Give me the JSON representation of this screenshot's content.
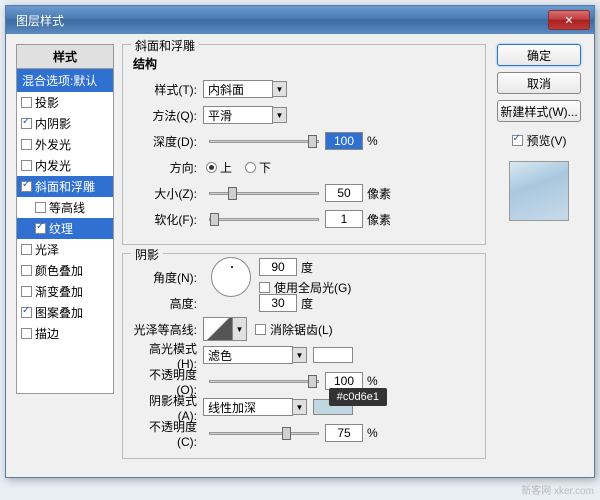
{
  "window": {
    "title": "图层样式"
  },
  "sidebar": {
    "header": "样式",
    "blend_defaults": "混合选项:默认",
    "items": [
      {
        "label": "投影",
        "checked": false
      },
      {
        "label": "内阴影",
        "checked": true
      },
      {
        "label": "外发光",
        "checked": false
      },
      {
        "label": "内发光",
        "checked": false
      },
      {
        "label": "斜面和浮雕",
        "checked": true,
        "active": true
      },
      {
        "label": "等高线",
        "checked": false,
        "sub": true
      },
      {
        "label": "纹理",
        "checked": true,
        "sub": true,
        "active": true
      },
      {
        "label": "光泽",
        "checked": false
      },
      {
        "label": "颜色叠加",
        "checked": false
      },
      {
        "label": "渐变叠加",
        "checked": false
      },
      {
        "label": "图案叠加",
        "checked": true
      },
      {
        "label": "描边",
        "checked": false
      }
    ]
  },
  "bevel": {
    "group_title": "斜面和浮雕",
    "structure": "结构",
    "style_label": "样式(T):",
    "style_value": "内斜面",
    "technique_label": "方法(Q):",
    "technique_value": "平滑",
    "depth_label": "深度(D):",
    "depth_value": "100",
    "depth_unit": "%",
    "direction_label": "方向:",
    "up": "上",
    "down": "下",
    "size_label": "大小(Z):",
    "size_value": "50",
    "size_unit": "像素",
    "soften_label": "软化(F):",
    "soften_value": "1",
    "soften_unit": "像素"
  },
  "shading": {
    "group_title": "阴影",
    "angle_label": "角度(N):",
    "angle_value": "90",
    "deg": "度",
    "global_light": "使用全局光(G)",
    "altitude_label": "高度:",
    "altitude_value": "30",
    "contour_label": "光泽等高线:",
    "antialias": "消除锯齿(L)",
    "hmode_label": "高光模式(H):",
    "hmode_value": "滤色",
    "hopacity_label": "不透明度(O):",
    "hopacity_value": "100",
    "pct": "%",
    "smode_label": "阴影模式(A):",
    "smode_value": "线性加深",
    "sopacity_label": "不透明度(C):",
    "sopacity_value": "75",
    "shadow_color": "#c0d6e1"
  },
  "buttons": {
    "ok": "确定",
    "cancel": "取消",
    "new_style": "新建样式(W)...",
    "preview": "预览(V)"
  },
  "tooltip": "#c0d6e1",
  "watermark": "新客网 xker.com"
}
